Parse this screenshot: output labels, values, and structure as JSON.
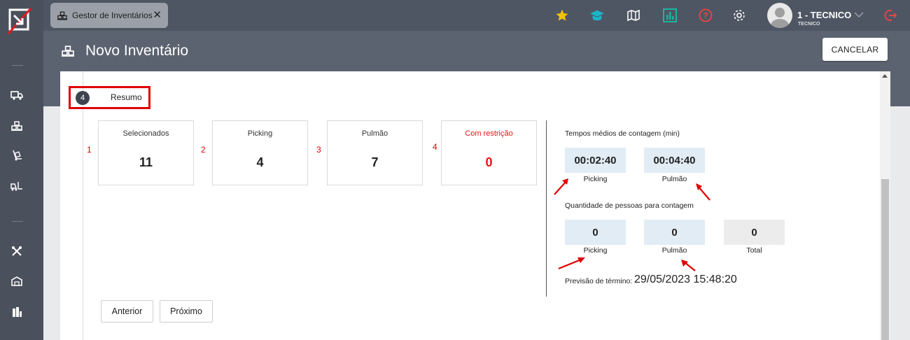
{
  "tab": {
    "label": "Gestor de Inventários",
    "close": "✕"
  },
  "user": {
    "name": "1 - TECNICO",
    "role": "TECNICO"
  },
  "page": {
    "title": "Novo Inventário",
    "cancel_label": "CANCELAR"
  },
  "step": {
    "number": "4",
    "label": "Resumo"
  },
  "cards": [
    {
      "annotation": "1",
      "title": "Selecionados",
      "value": "11"
    },
    {
      "annotation": "2",
      "title": "Picking",
      "value": "4"
    },
    {
      "annotation": "3",
      "title": "Pulmão",
      "value": "7"
    },
    {
      "annotation": "4",
      "title": "Com restrição",
      "value": "0"
    }
  ],
  "times": {
    "title": "Tempos médios de contagem (min)",
    "picking": {
      "value": "00:02:40",
      "label": "Picking"
    },
    "pulmao": {
      "value": "00:04:40",
      "label": "Pulmão"
    }
  },
  "people": {
    "title": "Quantidade de pessoas para contagem",
    "picking": {
      "value": "0",
      "label": "Picking"
    },
    "pulmao": {
      "value": "0",
      "label": "Pulmão"
    },
    "total": {
      "value": "0",
      "label": "Total"
    }
  },
  "forecast": {
    "label": "Previsão de término:",
    "value": "29/05/2023 15:48:20"
  },
  "nav": {
    "prev_label": "Anterior",
    "next_label": "Próximo"
  },
  "colors": {
    "annotation_red": "#e00000",
    "restriction_red": "#ee1111",
    "star": "#f2c200",
    "accent_teal": "#1ab5c9",
    "danger": "#ee4444"
  },
  "icons": {
    "sidebar": [
      "app-logo-icon",
      "truck-icon",
      "pallet-boxes-icon",
      "hand-truck-icon",
      "forklift-icon",
      "tools-icon",
      "warehouse-icon",
      "buildings-icon"
    ],
    "toolbar": [
      "star-icon",
      "graduation-cap-icon",
      "map-icon",
      "chart-icon",
      "help-icon",
      "gear-icon",
      "logout-icon"
    ]
  }
}
